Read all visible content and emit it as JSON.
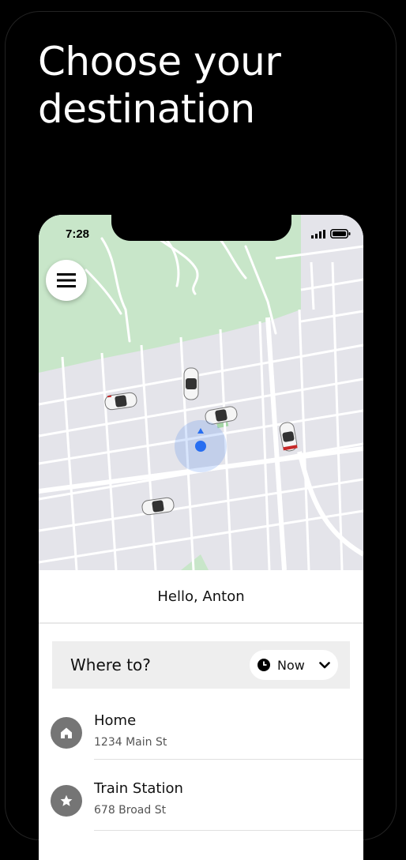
{
  "headline": {
    "line1": "Choose your",
    "line2": "destination"
  },
  "status_bar": {
    "time": "7:28"
  },
  "greeting": "Hello, Anton",
  "search": {
    "label": "Where to?",
    "time_option": "Now"
  },
  "saved_places": [
    {
      "name": "Home",
      "address": "1234 Main St",
      "icon": "home-icon"
    },
    {
      "name": "Train Station",
      "address": "678 Broad St",
      "icon": "star-icon"
    }
  ],
  "colors": {
    "background": "#000000",
    "map_park": "#c8e6c9",
    "map_streets": "#e4e4ea",
    "location_dot": "#276ef1",
    "search_bar": "#eeeeee",
    "place_icon": "#757575"
  }
}
